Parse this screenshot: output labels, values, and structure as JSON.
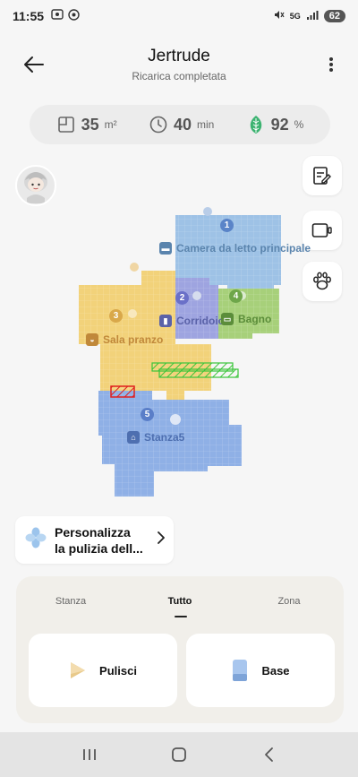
{
  "status_bar": {
    "time": "11:55",
    "network": "5G",
    "battery": "62",
    "left_icons": [
      "screenshot-icon",
      "at-icon"
    ],
    "right_icons": [
      "mute-icon",
      "wifi-icon",
      "signal-icon",
      "battery-icon"
    ]
  },
  "header": {
    "title": "Jertrude",
    "subtitle": "Ricarica completata",
    "back_icon": "arrow-left-icon",
    "menu_icon": "more-vertical-icon"
  },
  "stats": {
    "area": {
      "value": "35",
      "unit": "m²",
      "icon": "area-icon"
    },
    "time": {
      "value": "40",
      "unit": "min",
      "icon": "clock-icon"
    },
    "battery": {
      "value": "92",
      "unit": "%",
      "icon": "battery-leaf-icon"
    }
  },
  "side_buttons": [
    {
      "name": "edit-map-button",
      "icon": "edit-map-icon"
    },
    {
      "name": "video-button",
      "icon": "video-icon"
    },
    {
      "name": "pet-button",
      "icon": "paw-icon"
    }
  ],
  "map": {
    "rooms": [
      {
        "number": "1",
        "label": "Camera da letto principale",
        "color": "#9ec2e6",
        "label_color": "#5a84ad"
      },
      {
        "number": "2",
        "label": "Corridoio",
        "color": "#9ea4e0",
        "label_color": "#5a62a8"
      },
      {
        "number": "3",
        "label": "Sala pranzo",
        "color": "#f2d27a",
        "label_color": "#c0883a"
      },
      {
        "number": "4",
        "label": "Bagno",
        "color": "#a7d07a",
        "label_color": "#5b8d3a"
      },
      {
        "number": "5",
        "label": "Stanza5",
        "color": "#8fb0e6",
        "label_color": "#4e6fb0"
      }
    ],
    "no_go_zone_color": "#e02020",
    "virtual_wall_color": "#3ac53a"
  },
  "custom_card": {
    "line1": "Personalizza",
    "line2": "la pulizia dell...",
    "icon": "customize-clover-icon"
  },
  "tabs": [
    {
      "label": "Stanza",
      "active": false
    },
    {
      "label": "Tutto",
      "active": true
    },
    {
      "label": "Zona",
      "active": false
    }
  ],
  "actions": {
    "clean_label": "Pulisci",
    "base_label": "Base"
  },
  "nav": {
    "recents_icon": "recents-icon",
    "home_icon": "home-icon",
    "back_icon": "nav-back-icon"
  }
}
